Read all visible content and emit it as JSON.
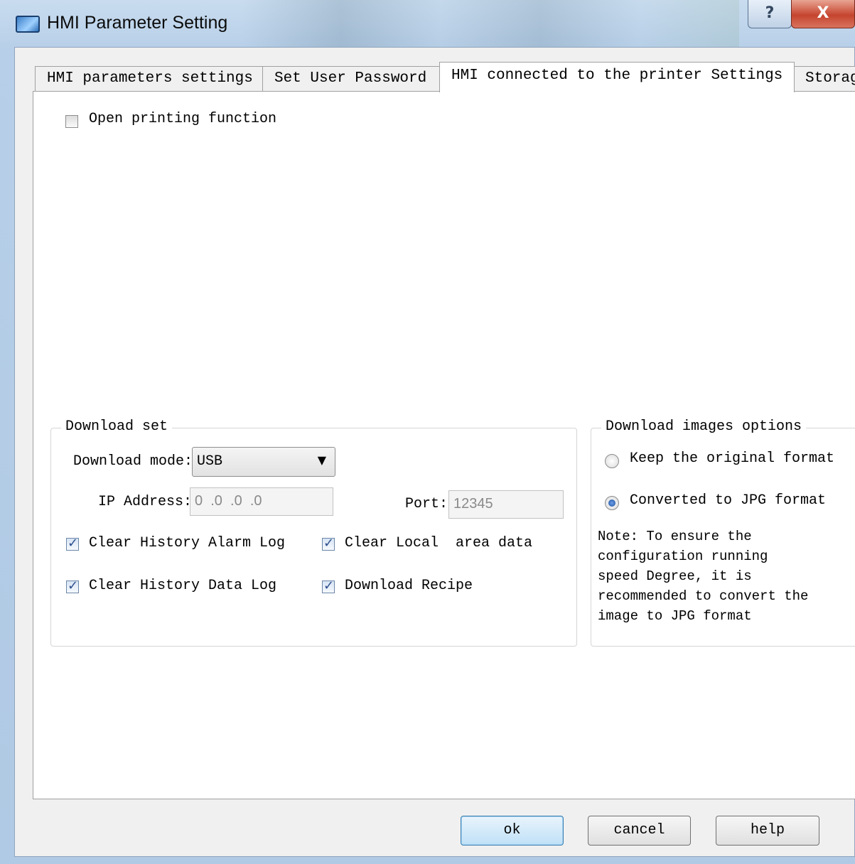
{
  "window": {
    "title": "HMI Parameter Setting",
    "help_glyph": "?",
    "close_glyph": "X"
  },
  "tabs": [
    {
      "label": "HMI parameters settings"
    },
    {
      "label": "Set User Password"
    },
    {
      "label": "HMI connected to the printer Settings"
    },
    {
      "label": "Storage"
    }
  ],
  "printing": {
    "label": "Open printing function",
    "checked": false
  },
  "download_set": {
    "title": "Download set",
    "mode_label": "Download mode:",
    "mode_value": "USB",
    "ip_label": "IP Address:",
    "ip_value": "0  .0  .0  .0",
    "port_label": "Port:",
    "port_value": "12345",
    "options": [
      {
        "label": "Clear History Alarm Log",
        "checked": true
      },
      {
        "label": "Clear Local  area data",
        "checked": true
      },
      {
        "label": "Clear History Data Log",
        "checked": true
      },
      {
        "label": "Download Recipe",
        "checked": true
      }
    ]
  },
  "images": {
    "title": "Download images options",
    "keep_label": "Keep the original format",
    "convert_label": "Converted to JPG format",
    "selected": "Converted to JPG format",
    "note_lines": [
      "Note: To ensure the",
      "configuration running",
      "speed Degree, it is",
      "recommended to convert the",
      "image to JPG format"
    ]
  },
  "buttons": {
    "ok": "ok",
    "cancel": "cancel",
    "help": "help"
  },
  "icons": {
    "checkmark": "✓",
    "dropdown": "▼"
  }
}
